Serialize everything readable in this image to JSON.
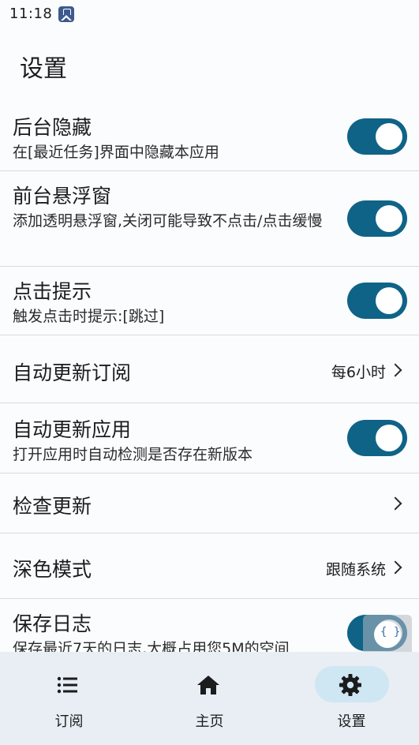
{
  "status_bar": {
    "time": "11:18",
    "app_icon": "game-controller-icon"
  },
  "header": {
    "title": "设置"
  },
  "settings": [
    {
      "key": "hide_background",
      "title": "后台隐藏",
      "description": "在[最近任务]界面中隐藏本应用",
      "control": "toggle",
      "enabled": true
    },
    {
      "key": "floating_window",
      "title": "前台悬浮窗",
      "description": "添加透明悬浮窗,关闭可能导致不点击/点击缓慢",
      "control": "toggle",
      "enabled": true
    },
    {
      "key": "click_tip",
      "title": "点击提示",
      "description": "触发点击时提示:[跳过]",
      "control": "toggle",
      "enabled": true
    },
    {
      "key": "auto_update_subscription",
      "title": "自动更新订阅",
      "value": "每6小时",
      "control": "chevron"
    },
    {
      "key": "auto_update_app",
      "title": "自动更新应用",
      "description": "打开应用时自动检测是否存在新版本",
      "control": "toggle",
      "enabled": true
    },
    {
      "key": "check_update",
      "title": "检查更新",
      "control": "chevron"
    },
    {
      "key": "dark_mode",
      "title": "深色模式",
      "value": "跟随系统",
      "control": "chevron"
    },
    {
      "key": "save_log",
      "title": "保存日志",
      "description": "保存最近7天的日志,大概占用您5M的空间",
      "control": "toggle",
      "enabled": true
    }
  ],
  "bottom_nav": [
    {
      "label": "订阅",
      "icon": "list-icon",
      "active": false
    },
    {
      "label": "主页",
      "icon": "home-icon",
      "active": false
    },
    {
      "label": "设置",
      "icon": "gear-icon",
      "active": true
    }
  ],
  "colors": {
    "accent": "#0f6387",
    "nav_background": "#e8eef3",
    "active_pill": "#cfe6f3",
    "background": "#fbfcfd"
  }
}
